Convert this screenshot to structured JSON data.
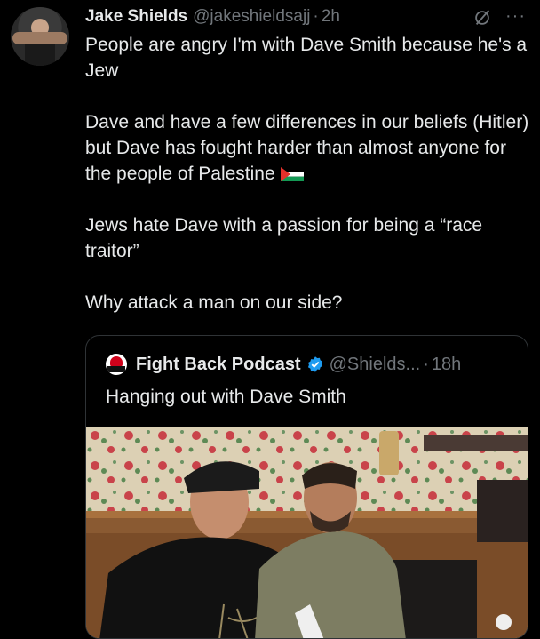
{
  "tweet": {
    "author_name": "Jake Shields",
    "author_handle": "@jakeshieldsajj",
    "separator": "·",
    "time": "2h",
    "more_label": "···",
    "lines": [
      "People are angry I'm with Dave Smith because he's a Jew",
      "",
      "Dave and have a few differences in our beliefs (Hitler) but Dave has fought harder than almost anyone for the people of Palestine",
      "",
      "Jews hate Dave with a passion for being a “race traitor”",
      "",
      "Why attack a man on our side?"
    ]
  },
  "quote": {
    "author_name": "Fight Back Podcast",
    "author_handle": "@Shields...",
    "separator": "·",
    "time": "18h",
    "text": "Hanging out with Dave Smith"
  },
  "icons": {
    "avatar": "profile-photo",
    "grok": "grok-slash-icon",
    "flag": "palestine-flag-icon",
    "verified": "verified-badge-icon",
    "accent": "#1d9bf0"
  }
}
